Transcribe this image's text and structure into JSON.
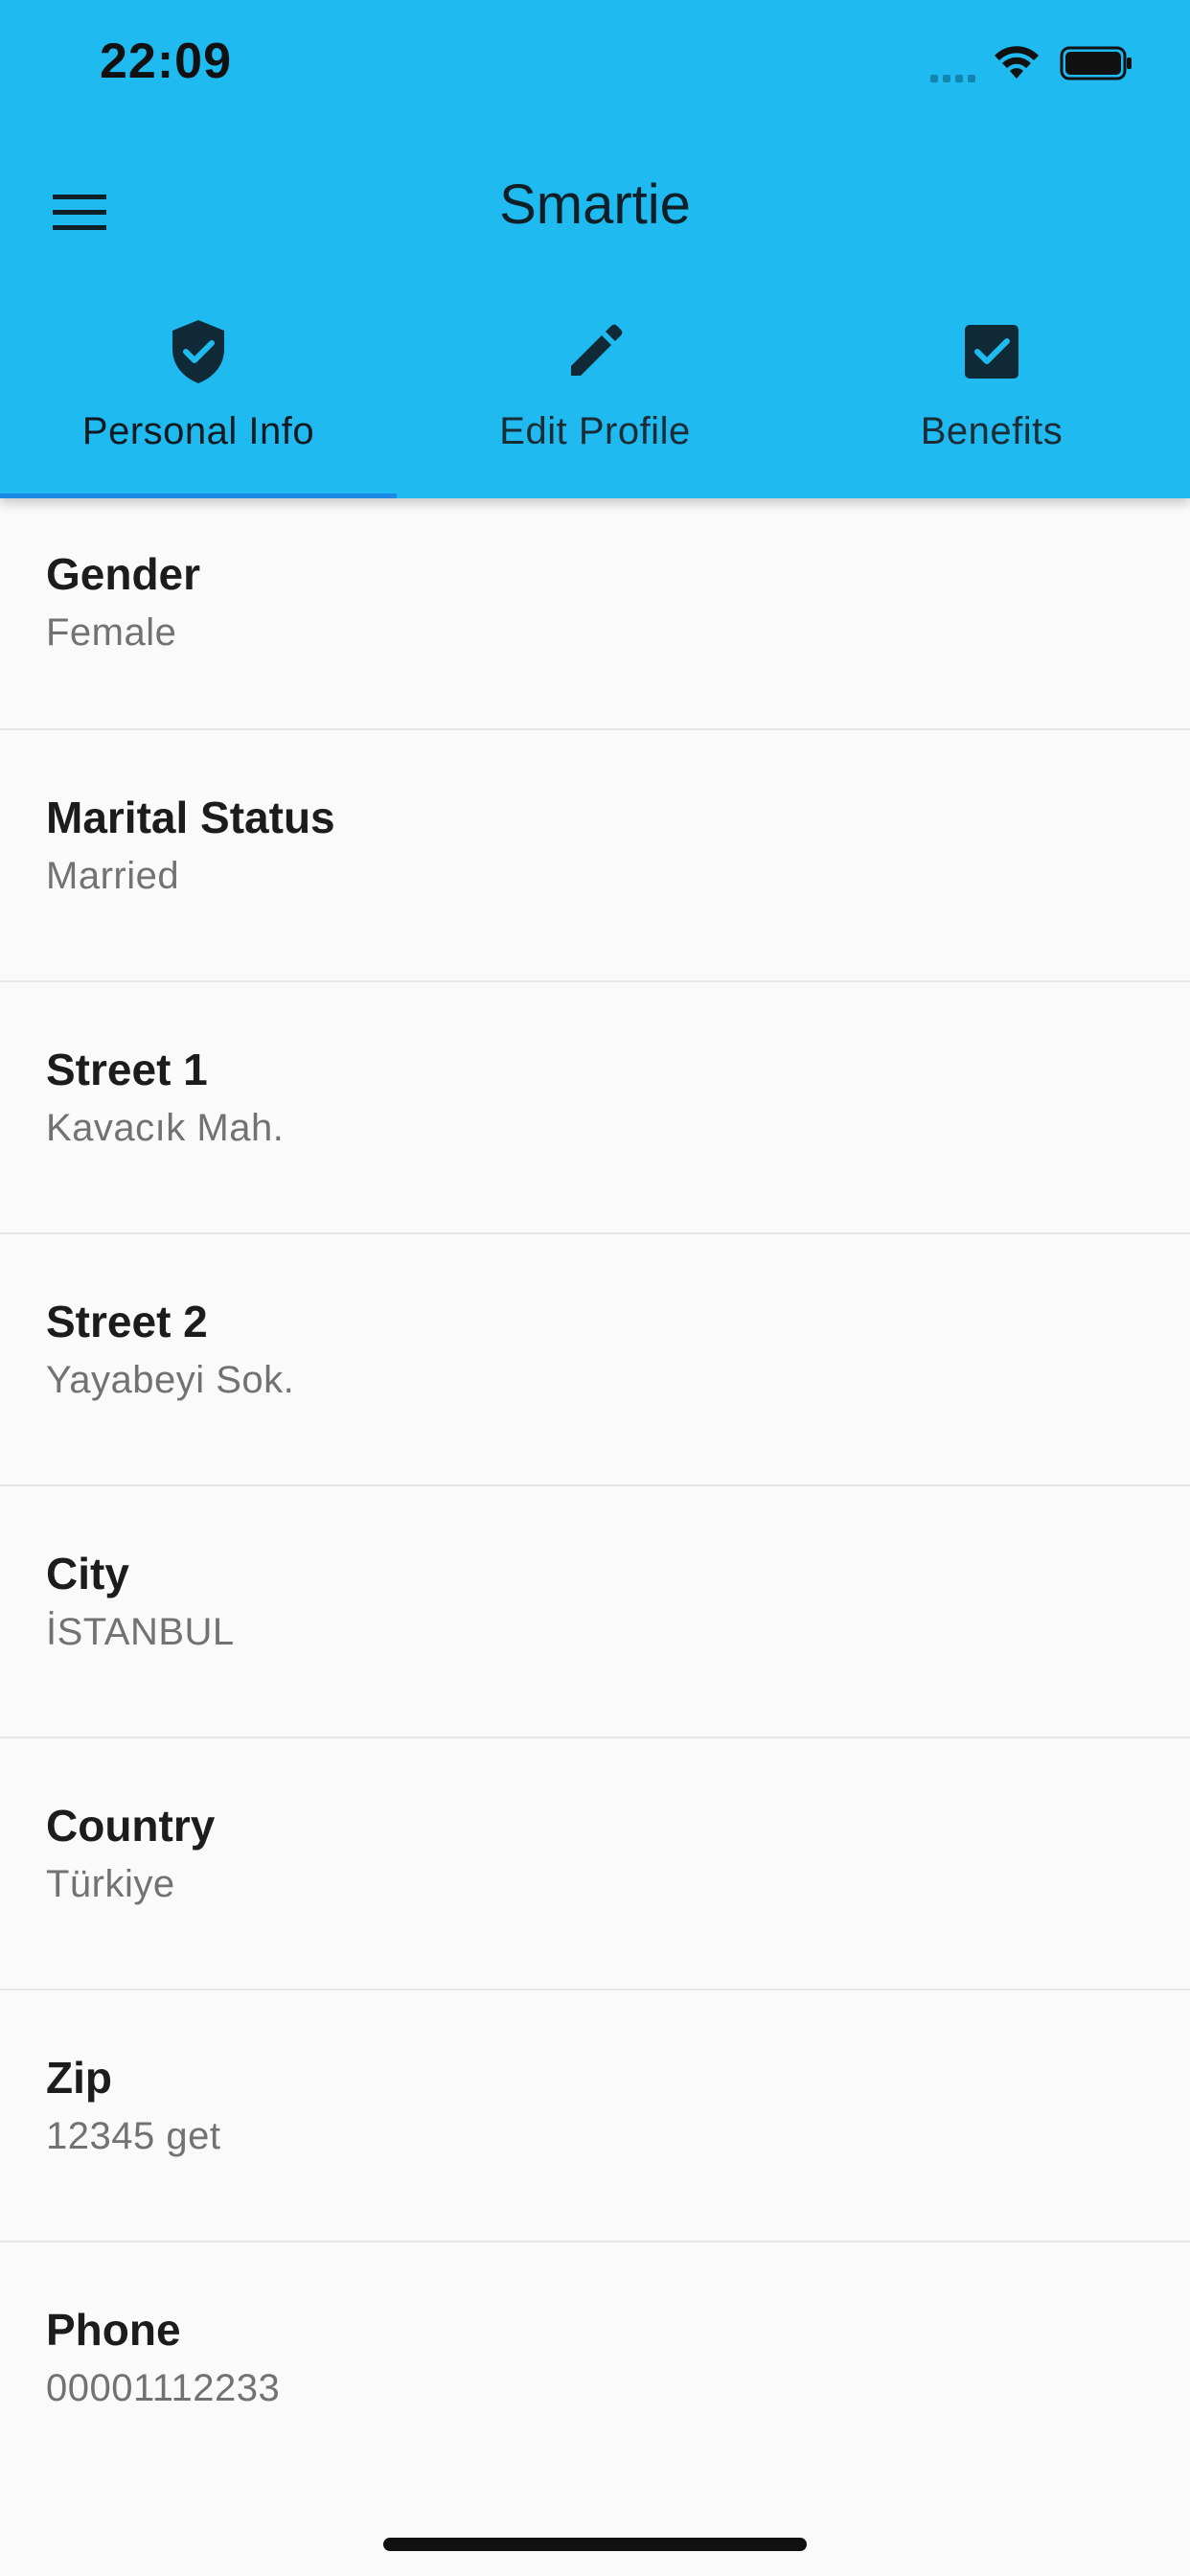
{
  "status_bar": {
    "time": "22:09"
  },
  "app_bar": {
    "title": "Smartie"
  },
  "tabs": [
    {
      "label": "Personal Info",
      "icon": "shield-check-icon",
      "active": true
    },
    {
      "label": "Edit Profile",
      "icon": "pencil-icon",
      "active": false
    },
    {
      "label": "Benefits",
      "icon": "checkbox-icon",
      "active": false
    }
  ],
  "fields": [
    {
      "label": "Gender",
      "value": "Female"
    },
    {
      "label": "Marital Status",
      "value": "Married"
    },
    {
      "label": "Street 1",
      "value": "Kavacık Mah."
    },
    {
      "label": "Street 2",
      "value": "Yayabeyi Sok."
    },
    {
      "label": "City",
      "value": "İSTANBUL"
    },
    {
      "label": "Country",
      "value": "Türkiye"
    },
    {
      "label": "Zip",
      "value": "12345 get"
    },
    {
      "label": "Phone",
      "value": "00001112233"
    }
  ],
  "colors": {
    "app_bar": "#1fbaf0",
    "tab_indicator": "#1e88e5",
    "background": "#fafafa",
    "icon_dark": "#0f2a36"
  }
}
